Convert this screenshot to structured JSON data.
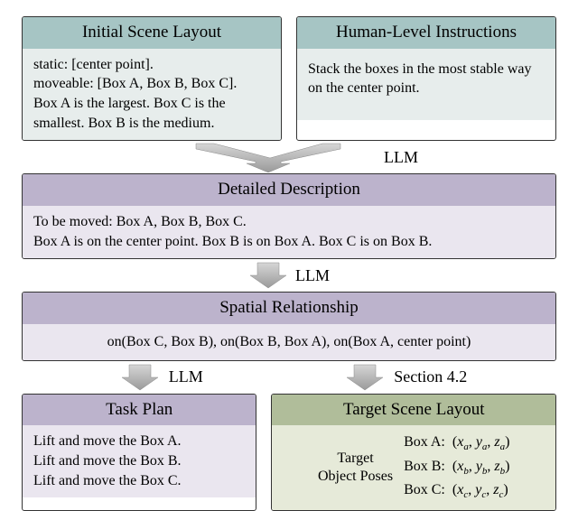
{
  "top": {
    "scene": {
      "title": "Initial Scene Layout",
      "line1": "static: [center point].",
      "line2": "moveable: [Box A, Box B, Box C].",
      "line3": "Box A is the largest. Box C is the smallest. Box B is the medium."
    },
    "instr": {
      "title": "Human-Level Instructions",
      "text": "Stack the boxes in the most stable way on the center point."
    }
  },
  "arrows": {
    "llm": "LLM",
    "section": "Section 4.2"
  },
  "detailed": {
    "title": "Detailed Description",
    "line1": "To be moved: Box A, Box B, Box C.",
    "line2": "Box A is on the center point. Box B is on Box A. Box C is on Box B."
  },
  "spatial": {
    "title": "Spatial Relationship",
    "text": "on(Box C, Box B),   on(Box B, Box A),   on(Box A, center point)"
  },
  "taskplan": {
    "title": "Task Plan",
    "line1": "Lift and move the Box A.",
    "line2": "Lift and move the Box B.",
    "line3": "Lift and move the Box C."
  },
  "target": {
    "title": "Target Scene Layout",
    "left1": "Target",
    "left2": "Object Poses",
    "rows": {
      "a": {
        "label": "Box A:",
        "x": "x",
        "y": "y",
        "z": "z",
        "sub": "a"
      },
      "b": {
        "label": "Box B:",
        "x": "x",
        "y": "y",
        "z": "z",
        "sub": "b"
      },
      "c": {
        "label": "Box C:",
        "x": "x",
        "y": "y",
        "z": "z",
        "sub": "c"
      }
    }
  }
}
